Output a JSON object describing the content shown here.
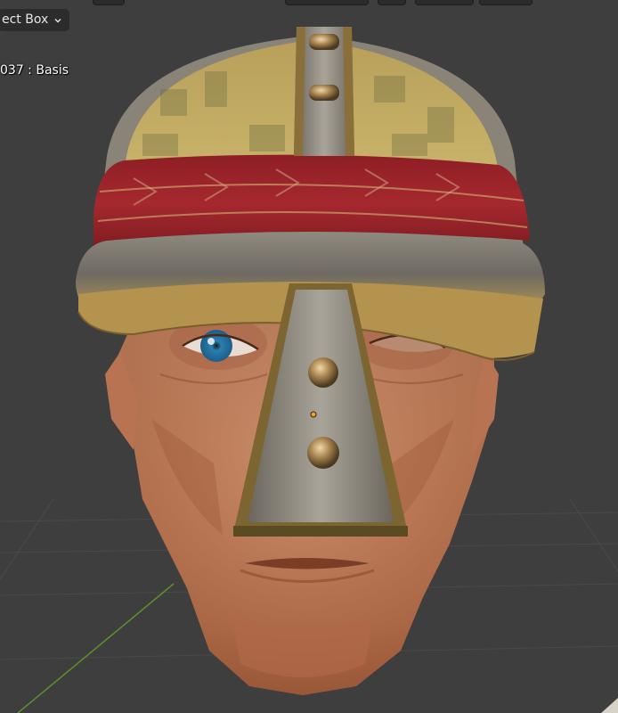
{
  "viewport": {
    "select_mode_label": "ect Box",
    "active_object_label": "037 : Basis",
    "icons": {
      "select_chevron": "chevron-down-icon",
      "origin_marker": "origin-dot-icon"
    },
    "colors": {
      "background": "#3e3e3e",
      "grid_line": "#4a4a4a",
      "y_axis": "#5a8a2a",
      "origin": "#f0a030"
    }
  }
}
